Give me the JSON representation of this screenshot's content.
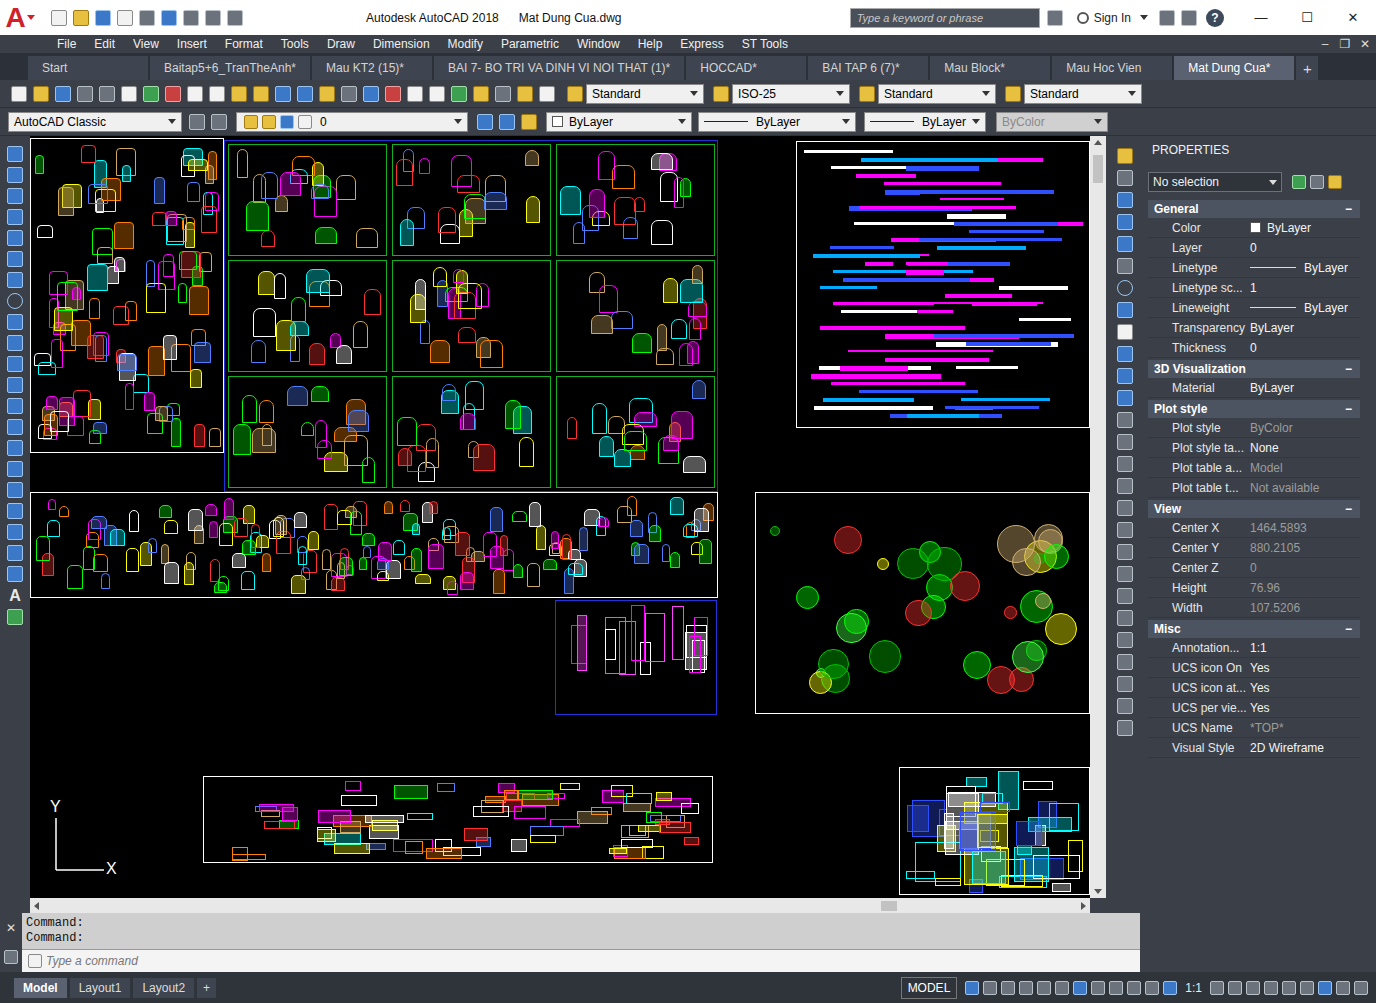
{
  "window": {
    "logo": "A",
    "title": "Autodesk AutoCAD 2018",
    "document": "Mat Dung Cua.dwg",
    "search_placeholder": "Type a keyword or phrase",
    "sign_in": "Sign In",
    "help": "?",
    "controls": [
      "—",
      "☐",
      "✕"
    ]
  },
  "menu": [
    "File",
    "Edit",
    "View",
    "Insert",
    "Format",
    "Tools",
    "Draw",
    "Dimension",
    "Modify",
    "Parametric",
    "Window",
    "Help",
    "Express",
    "ST Tools"
  ],
  "mdi_controls": [
    "–",
    "❐",
    "✕"
  ],
  "tabs": [
    {
      "label": "Start",
      "selected": false
    },
    {
      "label": "Baitap5+6_TranTheAnh*",
      "selected": false
    },
    {
      "label": "Mau KT2 (15)*",
      "selected": false
    },
    {
      "label": "BAI 7- BO TRI VA DINH VI NOI THAT (1)*",
      "selected": false
    },
    {
      "label": "HOCCAD*",
      "selected": false
    },
    {
      "label": "BAI TAP 6 (7)*",
      "selected": false
    },
    {
      "label": "Mau Block*",
      "selected": false
    },
    {
      "label": "Mau Hoc Vien",
      "selected": false
    },
    {
      "label": "Mat Dung Cua*",
      "selected": true
    }
  ],
  "new_tab": "+",
  "style_toolbar": [
    "Standard",
    "ISO-25",
    "Standard",
    "Standard"
  ],
  "properties_toolbar": {
    "workspace": "AutoCAD Classic",
    "layer": "0",
    "color": "ByLayer",
    "linetype": "ByLayer",
    "lineweight": "ByLayer",
    "plot_style": {
      "value": "ByColor",
      "disabled": true
    }
  },
  "draw_toolbar": {
    "text_tool": "A"
  },
  "ucs": {
    "x": "X",
    "y": "Y"
  },
  "properties": {
    "title": "PROPERTIES",
    "selection": "No selection",
    "sections": [
      {
        "title": "General",
        "toggle": "−",
        "rows": [
          {
            "label": "Color",
            "value": "ByLayer",
            "kind": "color",
            "disabled": false
          },
          {
            "label": "Layer",
            "value": "0",
            "kind": "text",
            "disabled": false
          },
          {
            "label": "Linetype",
            "value": "ByLayer",
            "kind": "line",
            "disabled": false
          },
          {
            "label": "Linetype sc...",
            "value": "1",
            "kind": "text",
            "disabled": false
          },
          {
            "label": "Lineweight",
            "value": "ByLayer",
            "kind": "line",
            "disabled": false
          },
          {
            "label": "Transparency",
            "value": "ByLayer",
            "kind": "text",
            "disabled": false
          },
          {
            "label": "Thickness",
            "value": "0",
            "kind": "text",
            "disabled": false
          }
        ]
      },
      {
        "title": "3D Visualization",
        "toggle": "−",
        "rows": [
          {
            "label": "Material",
            "value": "ByLayer",
            "kind": "text",
            "disabled": false
          }
        ]
      },
      {
        "title": "Plot style",
        "toggle": "−",
        "rows": [
          {
            "label": "Plot style",
            "value": "ByColor",
            "kind": "text",
            "disabled": true
          },
          {
            "label": "Plot style ta...",
            "value": "None",
            "kind": "text",
            "disabled": false
          },
          {
            "label": "Plot table a...",
            "value": "Model",
            "kind": "text",
            "disabled": true
          },
          {
            "label": "Plot table t...",
            "value": "Not available",
            "kind": "text",
            "disabled": true
          }
        ]
      },
      {
        "title": "View",
        "toggle": "−",
        "rows": [
          {
            "label": "Center X",
            "value": "1464.5893",
            "kind": "text",
            "disabled": true
          },
          {
            "label": "Center Y",
            "value": "880.2105",
            "kind": "text",
            "disabled": true
          },
          {
            "label": "Center Z",
            "value": "0",
            "kind": "text",
            "disabled": true
          },
          {
            "label": "Height",
            "value": "76.96",
            "kind": "text",
            "disabled": true
          },
          {
            "label": "Width",
            "value": "107.5206",
            "kind": "text",
            "disabled": true
          }
        ]
      },
      {
        "title": "Misc",
        "toggle": "−",
        "rows": [
          {
            "label": "Annotation...",
            "value": "1:1",
            "kind": "text",
            "disabled": false
          },
          {
            "label": "UCS icon On",
            "value": "Yes",
            "kind": "text",
            "disabled": false
          },
          {
            "label": "UCS icon at...",
            "value": "Yes",
            "kind": "text",
            "disabled": false
          },
          {
            "label": "UCS per vie...",
            "value": "Yes",
            "kind": "text",
            "disabled": false
          },
          {
            "label": "UCS Name",
            "value": "*TOP*",
            "kind": "text",
            "disabled": true
          },
          {
            "label": "Visual Style",
            "value": "2D Wireframe",
            "kind": "text",
            "disabled": false
          }
        ]
      }
    ]
  },
  "command_line": {
    "close": "✕",
    "history": [
      "Command:",
      "Command:"
    ],
    "placeholder": "Type a command"
  },
  "status_bar": {
    "layouts": [
      {
        "label": "Model",
        "selected": true
      },
      {
        "label": "Layout1",
        "selected": false
      },
      {
        "label": "Layout2",
        "selected": false
      }
    ],
    "add": "+",
    "space": "MODEL",
    "scale": "1:1"
  }
}
